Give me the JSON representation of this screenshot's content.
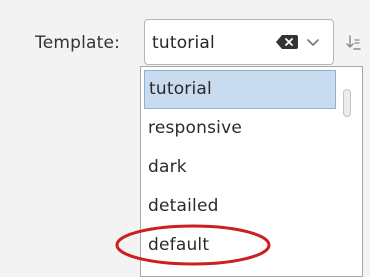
{
  "template_field": {
    "label": "Template:",
    "value": "tutorial",
    "clear_icon": "clear-icon",
    "chevron_icon": "chevron-down-icon",
    "sort_icon": "sort-icon"
  },
  "dropdown": {
    "options": [
      {
        "label": "tutorial"
      },
      {
        "label": "responsive"
      },
      {
        "label": "dark"
      },
      {
        "label": "detailed"
      },
      {
        "label": "default"
      }
    ],
    "selected_option": "tutorial",
    "annotated_option": "default"
  },
  "colors": {
    "selection": "#c9dbef",
    "annotation": "#cc1f1f"
  }
}
